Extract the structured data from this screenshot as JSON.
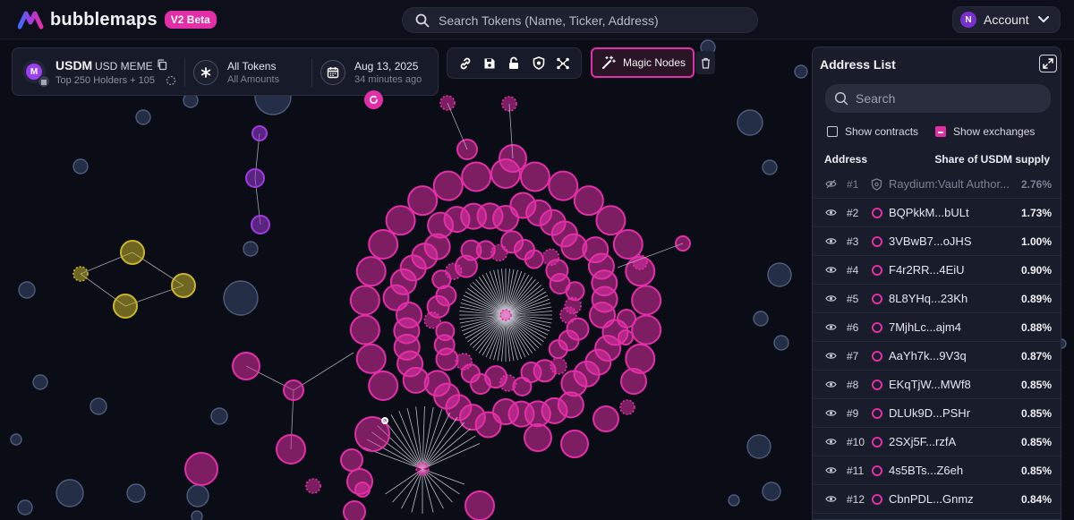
{
  "brand": {
    "name": "bubblemaps",
    "badge": "V2 Beta"
  },
  "search": {
    "placeholder": "Search Tokens (Name, Ticker, Address)"
  },
  "account": {
    "initial": "N",
    "label": "Account"
  },
  "token": {
    "logo_letter": "M",
    "ticker": "USDM",
    "name": "USD MEME",
    "holders": "Top 250 Holders + 105",
    "filter_label": "All Tokens",
    "filter_sub": "All Amounts",
    "date": "Aug 13, 2025",
    "date_sub": "34 minutes ago"
  },
  "toolbar": {
    "tools": [
      "link-icon",
      "save-icon",
      "lock-icon",
      "shield-icon",
      "network-icon"
    ],
    "magic_label": "Magic Nodes"
  },
  "colors": {
    "accent": "#e22fa7",
    "yellow": "#c9b52c",
    "purple": "#a23ae0",
    "bg": "#0a0c16"
  },
  "address_list": {
    "title": "Address List",
    "search_placeholder": "Search",
    "show_contracts": "Show contracts",
    "show_exchanges": "Show exchanges",
    "col_address": "Address",
    "col_share": "Share of USDM supply",
    "rows": [
      {
        "rank": "#1",
        "address": "Raydium:Vault Author...",
        "share": "2.76%",
        "type": "contract"
      },
      {
        "rank": "#2",
        "address": "BQPkkM...bULt",
        "share": "1.73%",
        "type": "wallet"
      },
      {
        "rank": "#3",
        "address": "3VBwB7...oJHS",
        "share": "1.00%",
        "type": "wallet"
      },
      {
        "rank": "#4",
        "address": "F4r2RR...4EiU",
        "share": "0.90%",
        "type": "wallet"
      },
      {
        "rank": "#5",
        "address": "8L8YHq...23Kh",
        "share": "0.89%",
        "type": "wallet"
      },
      {
        "rank": "#6",
        "address": "7MjhLc...ajm4",
        "share": "0.88%",
        "type": "wallet"
      },
      {
        "rank": "#7",
        "address": "AaYh7k...9V3q",
        "share": "0.87%",
        "type": "wallet"
      },
      {
        "rank": "#8",
        "address": "EKqTjW...MWf8",
        "share": "0.85%",
        "type": "wallet"
      },
      {
        "rank": "#9",
        "address": "DLUk9D...PSHr",
        "share": "0.85%",
        "type": "wallet"
      },
      {
        "rank": "#10",
        "address": "2SXj5F...rzfA",
        "share": "0.85%",
        "type": "wallet"
      },
      {
        "rank": "#11",
        "address": "4s5BTs...Z6eh",
        "share": "0.85%",
        "type": "wallet"
      },
      {
        "rank": "#12",
        "address": "CbnPDL...Gnmz",
        "share": "0.84%",
        "type": "wallet"
      }
    ]
  }
}
